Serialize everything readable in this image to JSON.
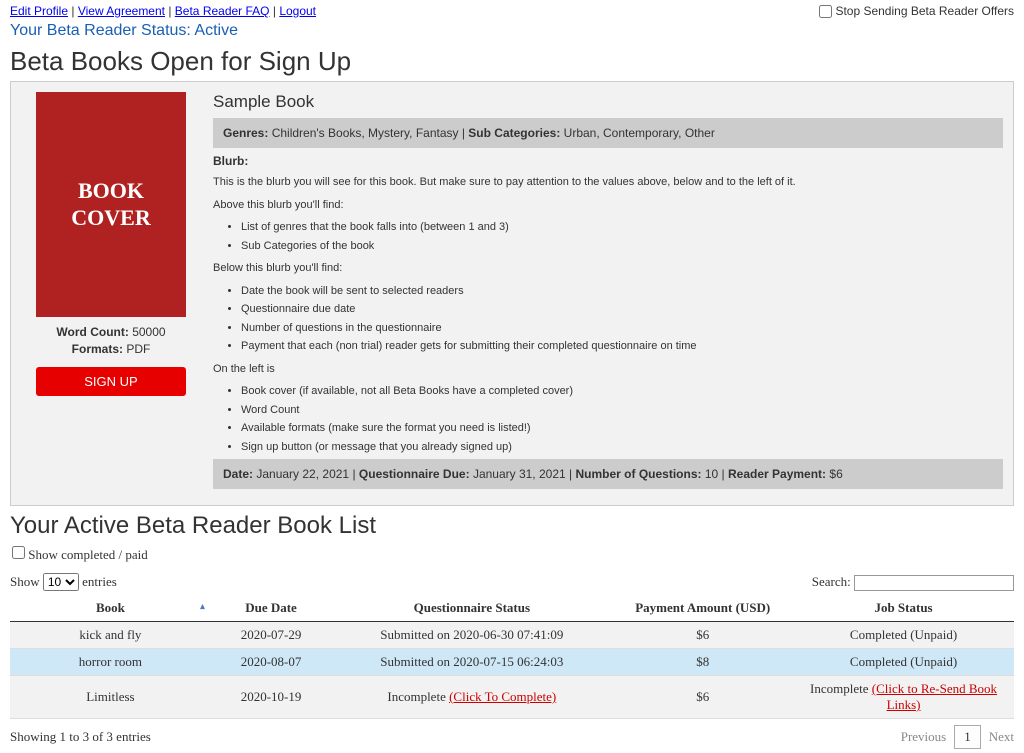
{
  "nav": {
    "edit_profile": "Edit Profile",
    "view_agreement": "View Agreement",
    "faq": "Beta Reader FAQ",
    "logout": "Logout"
  },
  "stop_offers_label": "Stop Sending Beta Reader Offers",
  "status_line": "Your Beta Reader Status: Active",
  "heading_open": "Beta Books Open for Sign Up",
  "book": {
    "cover_text": "BOOK COVER",
    "word_count_label": "Word Count:",
    "word_count_value": "50000",
    "formats_label": "Formats:",
    "formats_value": "PDF",
    "signup_label": "SIGN UP",
    "title": "Sample Book",
    "genres_label": "Genres:",
    "genres_value": "Children's Books, Mystery, Fantasy",
    "subcat_label": "Sub Categories:",
    "subcat_value": "Urban, Contemporary, Other",
    "blurb_label": "Blurb:",
    "blurb_intro": "This is the blurb you will see for this book.  But make sure to pay attention to the values above, below and to the left of it.",
    "above_label": "Above this blurb you'll find:",
    "above_items": [
      "List of genres that the book falls into (between 1 and 3)",
      "Sub Categories of the book"
    ],
    "below_label": "Below this blurb you'll find:",
    "below_items": [
      "Date the book will be sent to selected readers",
      "Questionnaire due date",
      "Number of questions in the questionnaire",
      "Payment that each (non trial) reader gets for submitting their completed questionnaire on time"
    ],
    "left_label": "On the left is",
    "left_items": [
      "Book cover (if available, not all Beta Books have a completed cover)",
      "Word Count",
      "Available formats (make sure the format you need is listed!)",
      "Sign up button (or message that you already signed up)"
    ],
    "date_label": "Date:",
    "date_value": "January 22, 2021",
    "qdue_label": "Questionnaire Due:",
    "qdue_value": "January 31, 2021",
    "numq_label": "Number of Questions:",
    "numq_value": "10",
    "pay_label": "Reader Payment:",
    "pay_value": "$6"
  },
  "heading_active": "Your Active Beta Reader Book List",
  "show_completed_label": "Show completed / paid",
  "show_label": "Show",
  "entries_label": "entries",
  "show_value": "10",
  "search_label": "Search:",
  "columns": {
    "book": "Book",
    "due": "Due Date",
    "qstatus": "Questionnaire Status",
    "pay": "Payment Amount (USD)",
    "job": "Job Status"
  },
  "rows": [
    {
      "book": "kick and fly",
      "due": "2020-07-29",
      "qstatus_plain": "Submitted on 2020-06-30 07:41:09",
      "qstatus_link": "",
      "pay": "$6",
      "job_plain": "Completed (Unpaid)",
      "job_link": "",
      "cls": "row-grey"
    },
    {
      "book": "horror room",
      "due": "2020-08-07",
      "qstatus_plain": "Submitted on 2020-07-15 06:24:03",
      "qstatus_link": "",
      "pay": "$8",
      "job_plain": "Completed (Unpaid)",
      "job_link": "",
      "cls": "row-blue"
    },
    {
      "book": "Limitless",
      "due": "2020-10-19",
      "qstatus_plain": "Incomplete ",
      "qstatus_link": "(Click To Complete)",
      "pay": "$6",
      "job_plain": "Incomplete ",
      "job_link": "(Click to Re-Send Book Links)",
      "cls": "row-grey"
    }
  ],
  "footer_info": "Showing 1 to 3 of 3 entries",
  "pager": {
    "prev": "Previous",
    "next": "Next",
    "page": "1"
  }
}
